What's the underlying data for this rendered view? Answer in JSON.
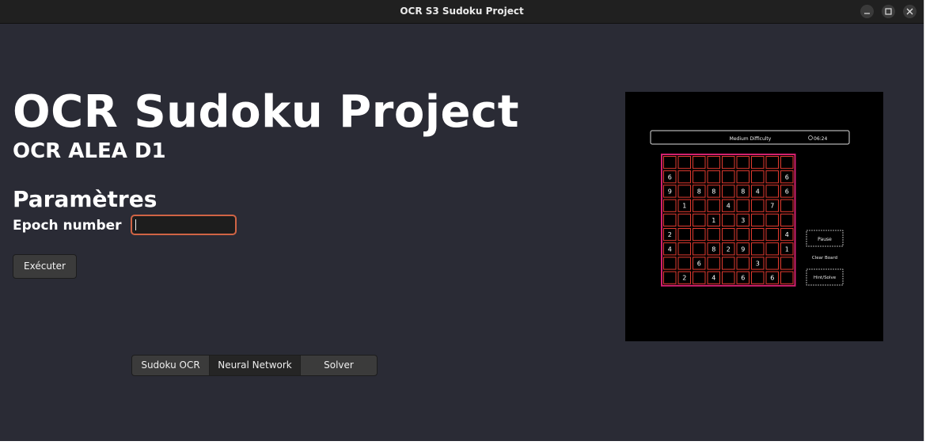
{
  "window": {
    "title": "OCR S3 Sudoku Project",
    "buttons": [
      "minimize",
      "maximize",
      "close"
    ]
  },
  "header": {
    "title": "OCR Sudoku Project",
    "subtitle": "OCR ALEA D1"
  },
  "params": {
    "heading": "Paramètres",
    "epoch_label": "Epoch number",
    "epoch_value": "",
    "run_label": "Exécuter"
  },
  "tabs": [
    {
      "label": "Sudoku OCR",
      "active": false
    },
    {
      "label": "Neural Network",
      "active": true
    },
    {
      "label": "Solver",
      "active": false
    }
  ],
  "preview": {
    "top_bar_label": "Medium Difficulty",
    "timer": "06:24",
    "buttons": [
      "Pause",
      "Clear Board",
      "Hint/Solve"
    ],
    "grid_digits": [
      [
        "",
        "",
        "",
        "",
        "",
        "",
        "",
        "",
        ""
      ],
      [
        "6",
        "",
        "",
        "",
        "",
        "",
        "",
        "",
        "6"
      ],
      [
        "9",
        "",
        "8",
        "8",
        "",
        "8",
        "4",
        "",
        "6"
      ],
      [
        "",
        "1",
        "",
        "",
        "4",
        "",
        "",
        "7",
        ""
      ],
      [
        "",
        "",
        "",
        "1",
        "",
        "3",
        "",
        "",
        ""
      ],
      [
        "2",
        "",
        "",
        "",
        "",
        "",
        "",
        "",
        "4"
      ],
      [
        "4",
        "",
        "",
        "8",
        "2",
        "9",
        "",
        "",
        "1"
      ],
      [
        "",
        "",
        "6",
        "",
        "",
        "",
        "3",
        "",
        ""
      ],
      [
        "",
        "2",
        "",
        "4",
        "",
        "6",
        "",
        "6",
        ""
      ]
    ],
    "colors": {
      "grid": "#d4206f",
      "cells": "#e03a2f",
      "text": "#ffffff"
    }
  }
}
